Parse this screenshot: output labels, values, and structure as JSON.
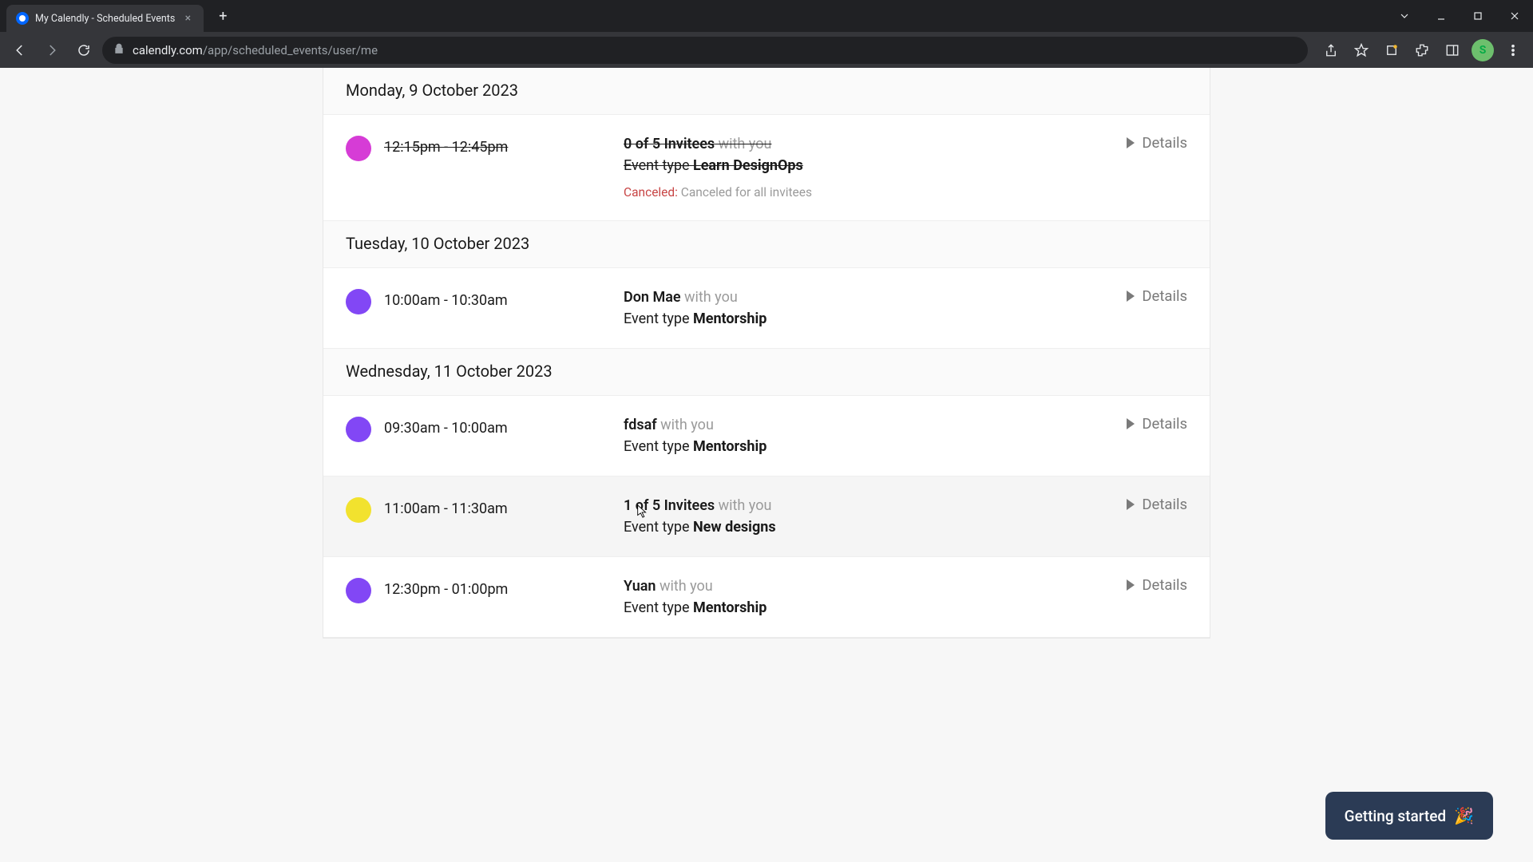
{
  "browser": {
    "tab_title": "My Calendly - Scheduled Events",
    "url_host": "calendly.com",
    "url_path": "/app/scheduled_events/user/me",
    "profile_initial": "S"
  },
  "labels": {
    "details": "Details",
    "with_you": " with you",
    "event_type_prefix": "Event type ",
    "canceled_label": "Canceled:",
    "canceled_msg": " Canceled for all invitees",
    "getting_started": "Getting started"
  },
  "days": [
    {
      "heading": "Monday, 9 October 2023",
      "events": [
        {
          "color": "pink",
          "time": "12:15pm - 12:45pm",
          "invitee": "0 of 5 Invitees",
          "event_type": "Learn DesignOps",
          "canceled": true,
          "struck": true
        }
      ]
    },
    {
      "heading": "Tuesday, 10 October 2023",
      "events": [
        {
          "color": "purple",
          "time": "10:00am - 10:30am",
          "invitee": "Don Mae",
          "event_type": "Mentorship",
          "canceled": false,
          "struck": false
        }
      ]
    },
    {
      "heading": "Wednesday, 11 October 2023",
      "events": [
        {
          "color": "purple",
          "time": "09:30am - 10:00am",
          "invitee": "fdsaf",
          "event_type": "Mentorship",
          "canceled": false,
          "struck": false
        },
        {
          "color": "yellow",
          "time": "11:00am - 11:30am",
          "invitee": "1 of 5 Invitees",
          "event_type": "New designs",
          "canceled": false,
          "struck": false,
          "hover": true
        },
        {
          "color": "purple",
          "time": "12:30pm - 01:00pm",
          "invitee": "Yuan",
          "event_type": "Mentorship",
          "canceled": false,
          "struck": false
        }
      ]
    }
  ]
}
